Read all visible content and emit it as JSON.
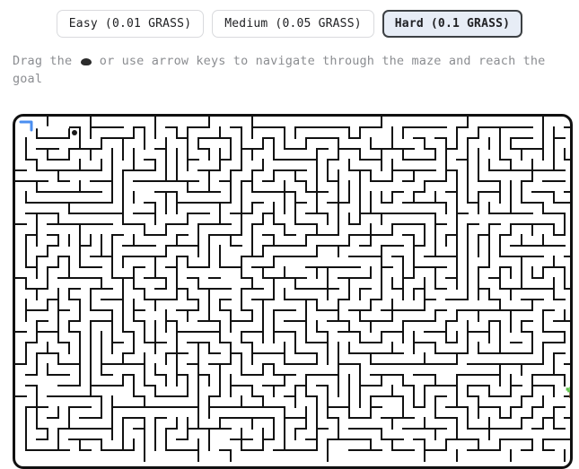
{
  "difficulty": {
    "options": [
      {
        "label": "Easy (0.01 GRASS)",
        "name": "easy",
        "selected": false
      },
      {
        "label": "Medium (0.05 GRASS)",
        "name": "medium",
        "selected": false
      },
      {
        "label": "Hard (0.1 GRASS)",
        "name": "hard",
        "selected": true
      }
    ],
    "selected_label": "Hard (0.1 GRASS)"
  },
  "instruction": {
    "text_before": "Drag the",
    "glyph": "player-token-glyph",
    "text_after": "or use arrow keys to navigate through the maze and reach the goal"
  },
  "maze": {
    "cell_size": 12,
    "cols": 52,
    "rows": 32,
    "wall_color": "#111111",
    "path_color": "#4a8ef0",
    "background": "#ffffff",
    "border_color": "#111111",
    "player": {
      "col": 5,
      "row": 1,
      "color": "#1a1a1a",
      "label": "player-token"
    },
    "goal": {
      "col": 51,
      "row": 25,
      "icon": "plant-icon",
      "leaf_color": "#5fc24a",
      "stem_color": "#7a5230"
    },
    "trail": {
      "color": "#4a8ef0",
      "points": [
        [
          0,
          0
        ],
        [
          12,
          0
        ],
        [
          12,
          9
        ]
      ]
    }
  }
}
